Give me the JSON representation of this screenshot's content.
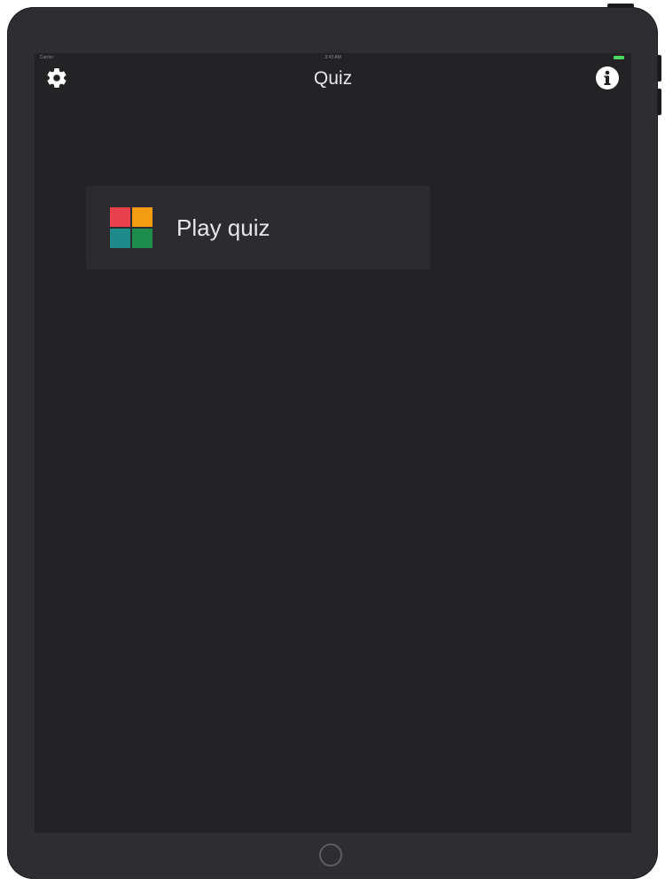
{
  "status_bar": {
    "carrier": "Carrier",
    "time": "3:43 AM"
  },
  "nav": {
    "title": "Quiz",
    "left_icon": "gear-icon",
    "right_icon": "info-icon"
  },
  "menu": {
    "items": [
      {
        "label": "Play quiz",
        "icon": "quiz-grid-icon",
        "icon_colors": [
          "#e8414d",
          "#f39c12",
          "#1f8a8a",
          "#1e8c4a"
        ]
      }
    ]
  },
  "device": {
    "home_button": "home-button"
  },
  "colors": {
    "screen_background": "#232225",
    "device_frame": "#2e2d31",
    "card_background": "#2c2b2f",
    "text": "#e8e8ea"
  }
}
